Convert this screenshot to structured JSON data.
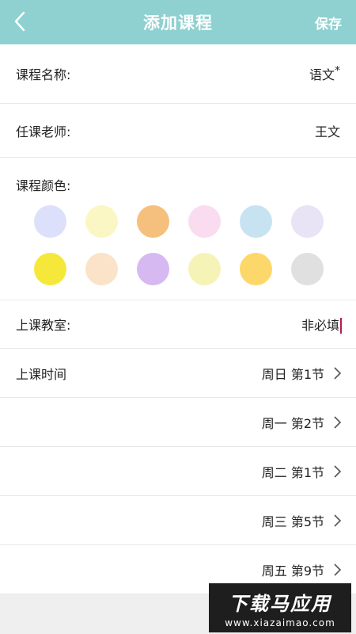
{
  "header": {
    "title": "添加课程",
    "save_label": "保存",
    "background": "#8fd0d0"
  },
  "form": {
    "course_name": {
      "label": "课程名称:",
      "value": "语文",
      "required_mark": "*"
    },
    "teacher": {
      "label": "任课老师:",
      "value": "王文"
    },
    "color": {
      "label": "课程颜色:",
      "swatches": [
        "#dde0fb",
        "#faf7c4",
        "#f5c07d",
        "#fadcf1",
        "#c7e3f1",
        "#e8e4f6",
        "#f6e83a",
        "#fae3c8",
        "#d6b9f1",
        "#f6f3b6",
        "#fcd86a",
        "#e0e0e0"
      ]
    },
    "classroom": {
      "label": "上课教室:",
      "placeholder": "非必填"
    },
    "time": {
      "label": "上课时间",
      "entries": [
        {
          "day": "周日",
          "period": "第1节"
        },
        {
          "day": "周一",
          "period": "第2节"
        },
        {
          "day": "周二",
          "period": "第1节"
        },
        {
          "day": "周三",
          "period": "第5节"
        },
        {
          "day": "周五",
          "period": "第9节"
        }
      ]
    }
  },
  "watermark": {
    "main": "下载马应用",
    "sub": "www.xiazaimao.com"
  }
}
